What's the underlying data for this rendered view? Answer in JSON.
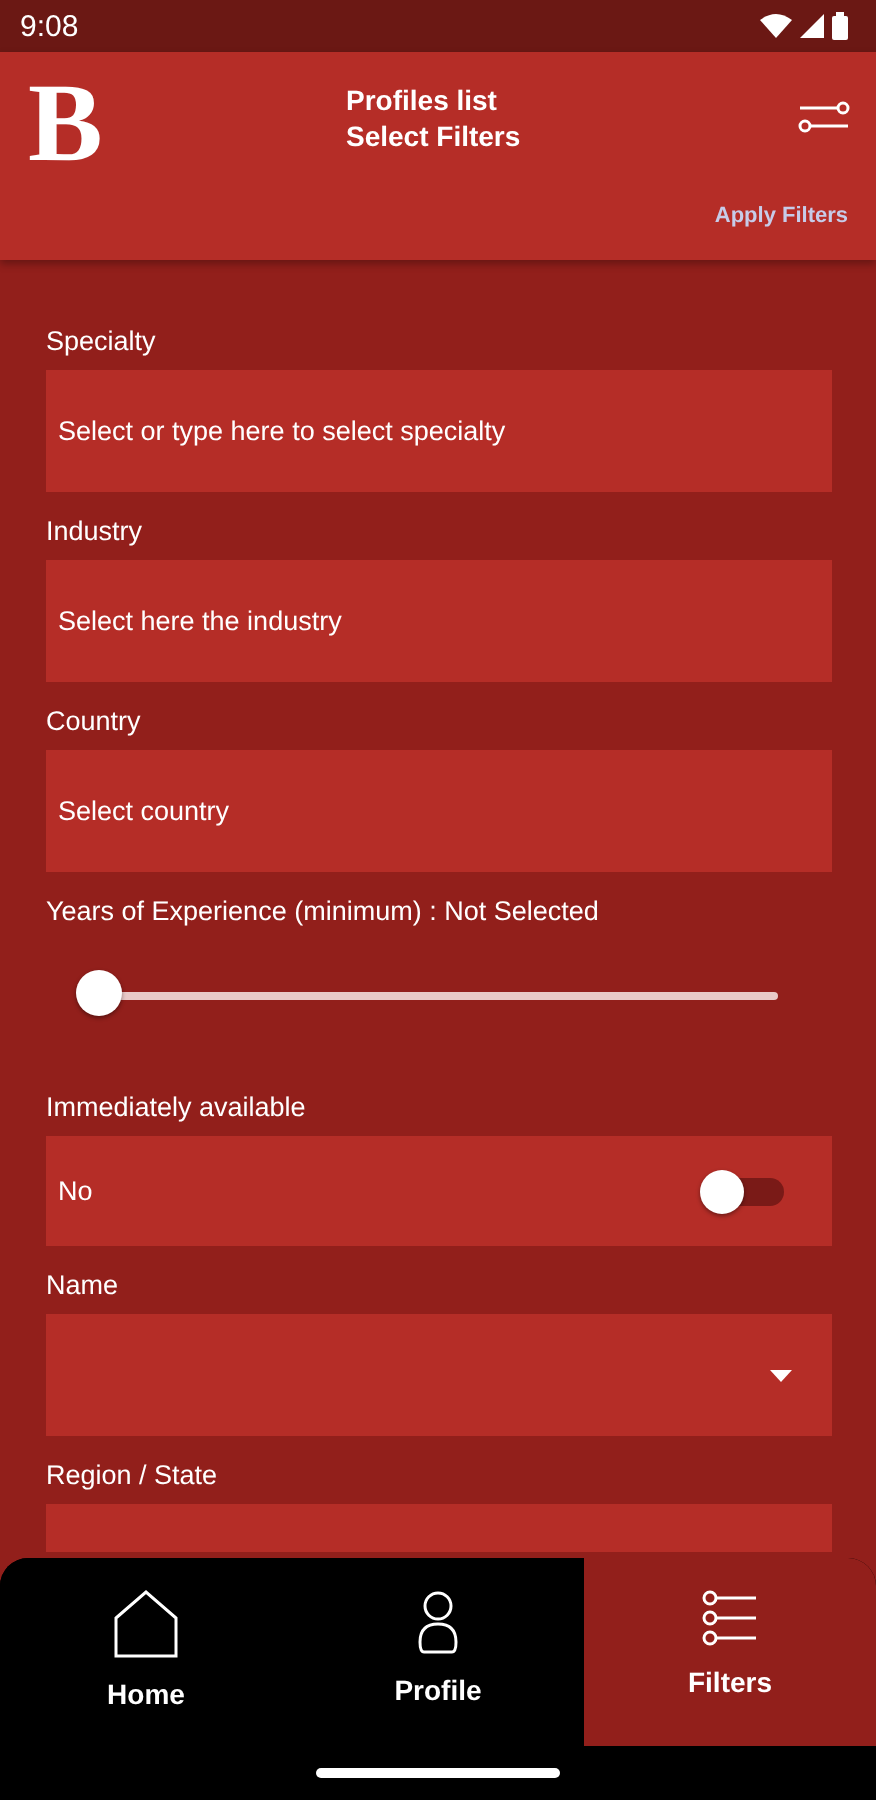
{
  "status_bar": {
    "time": "9:08"
  },
  "header": {
    "logo": "B",
    "title": "Profiles list",
    "subtitle": "Select Filters",
    "apply": "Apply Filters"
  },
  "filters": [
    {
      "kind": "select",
      "label": "Specialty",
      "placeholder": "Select or type here to select specialty"
    },
    {
      "kind": "select",
      "label": "Industry",
      "placeholder": "Select here the industry"
    },
    {
      "kind": "select",
      "label": "Country",
      "placeholder": "Select country"
    },
    {
      "kind": "slider",
      "label": "Years of Experience (minimum) : Not Selected",
      "level": 0
    },
    {
      "kind": "switch",
      "label": "Immediately available",
      "value": "No",
      "on": false
    },
    {
      "kind": "dropdown",
      "label": "Name"
    },
    {
      "kind": "select",
      "label": "Region / State"
    }
  ],
  "nav": [
    {
      "label": "Home",
      "selected": false
    },
    {
      "label": "Profile",
      "selected": false
    },
    {
      "label": "Filters",
      "selected": true
    }
  ]
}
